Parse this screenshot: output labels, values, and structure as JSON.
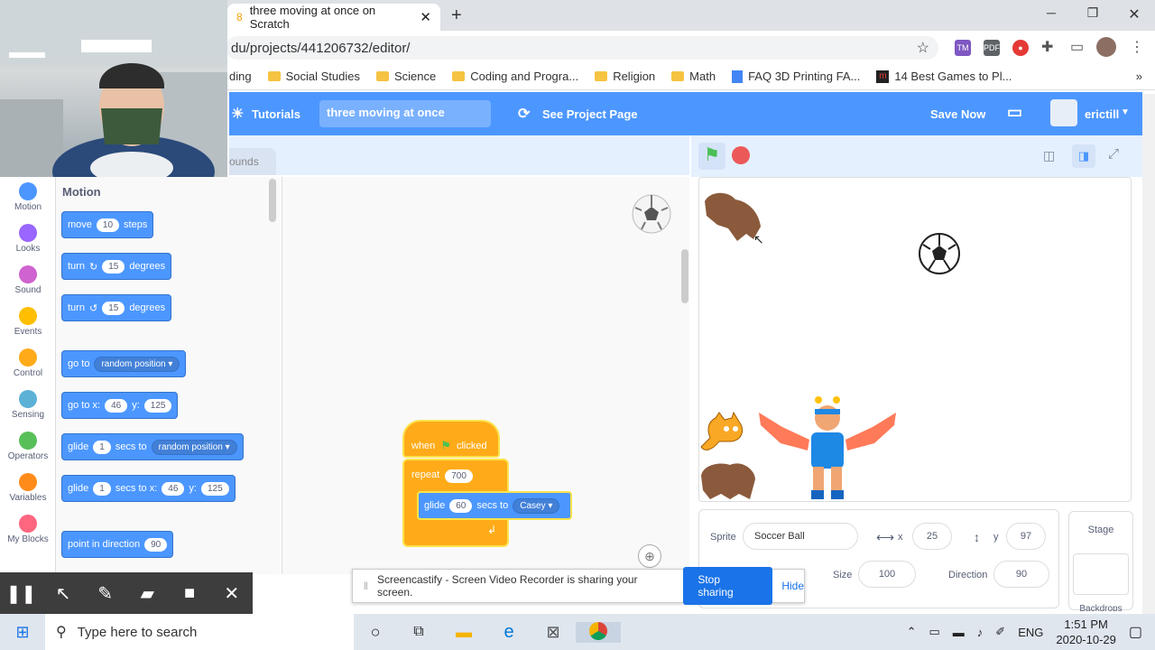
{
  "browser": {
    "tab_title": "three moving at once on Scratch",
    "tab_close": "✕",
    "new_tab": "+",
    "url": "du/projects/441206732/editor/",
    "star": "☆",
    "bookmarks": [
      {
        "label": "ding",
        "icon": "folder-icon"
      },
      {
        "label": "Social Studies",
        "icon": "folder-icon"
      },
      {
        "label": "Science",
        "icon": "folder-icon"
      },
      {
        "label": "Coding and Progra...",
        "icon": "folder-icon"
      },
      {
        "label": "Religion",
        "icon": "folder-icon"
      },
      {
        "label": "Math",
        "icon": "folder-icon"
      },
      {
        "label": "FAQ 3D Printing FA...",
        "icon": "doc-icon"
      },
      {
        "label": "14 Best Games to Pl...",
        "icon": "m-icon"
      }
    ],
    "more_bookmarks": "»"
  },
  "scratch": {
    "menu": {
      "tutorials": "Tutorials",
      "project_title": "three moving at once",
      "see_project_page": "See Project Page",
      "save_now": "Save Now",
      "username": "erictill"
    },
    "tabs": {
      "sounds": "ounds"
    },
    "categories": [
      {
        "label": "Motion",
        "color": "#4c97ff"
      },
      {
        "label": "Looks",
        "color": "#9966ff"
      },
      {
        "label": "Sound",
        "color": "#cf63cf"
      },
      {
        "label": "Events",
        "color": "#ffbf00"
      },
      {
        "label": "Control",
        "color": "#ffab19"
      },
      {
        "label": "Sensing",
        "color": "#5cb1d6"
      },
      {
        "label": "Operators",
        "color": "#59c059"
      },
      {
        "label": "Variables",
        "color": "#ff8c1a"
      },
      {
        "label": "My Blocks",
        "color": "#ff6680"
      }
    ],
    "palette": {
      "heading": "Motion",
      "move": {
        "a": "move",
        "v": "10",
        "b": "steps"
      },
      "turn_cw": {
        "a": "turn",
        "v": "15",
        "b": "degrees"
      },
      "turn_ccw": {
        "a": "turn",
        "v": "15",
        "b": "degrees"
      },
      "goto": {
        "a": "go to",
        "dd": "random position"
      },
      "gotoxy": {
        "a": "go to x:",
        "x": "46",
        "b": "y:",
        "y": "125"
      },
      "glide_to": {
        "a": "glide",
        "v": "1",
        "b": "secs to",
        "dd": "random position"
      },
      "glide_xy": {
        "a": "glide",
        "v": "1",
        "b": "secs to x:",
        "x": "46",
        "c": "y:",
        "y": "125"
      },
      "point": {
        "a": "point in direction",
        "v": "90"
      }
    },
    "script": {
      "hat_a": "when",
      "hat_b": "clicked",
      "repeat": "repeat",
      "repeat_v": "700",
      "glide": "glide",
      "glide_v": "60",
      "glide_b": "secs to",
      "glide_dd": "Casey"
    },
    "sprite": {
      "label": "Sprite",
      "name": "Soccer Ball",
      "x_label": "x",
      "x": "25",
      "y_label": "y",
      "y": "97",
      "size_label": "Size",
      "size": "100",
      "dir_label": "Direction",
      "direction": "90"
    },
    "stage_panel": {
      "title": "Stage",
      "backdrops": "Backdrops"
    }
  },
  "recorder": {
    "message": "Screencastify - Screen Video Recorder is sharing your screen.",
    "stop": "Stop sharing",
    "hide": "Hide"
  },
  "taskbar": {
    "search_placeholder": "Type here to search",
    "lang": "ENG",
    "time": "1:51 PM",
    "date": "2020-10-29"
  }
}
